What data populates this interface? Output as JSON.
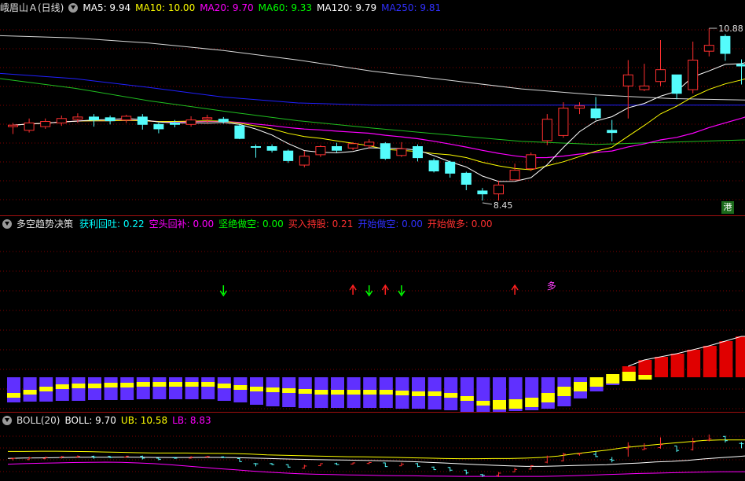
{
  "main_panel": {
    "title": "峨眉山Ａ(日线)",
    "indicators": [
      {
        "label": "MA5:",
        "value": "9.94",
        "color": "#ffffff"
      },
      {
        "label": "MA10:",
        "value": "10.00",
        "color": "#ffff00"
      },
      {
        "label": "MA20:",
        "value": "9.70",
        "color": "#ff00ff"
      },
      {
        "label": "MA60:",
        "value": "9.33",
        "color": "#00ff00"
      },
      {
        "label": "MA120:",
        "value": "9.79",
        "color": "#ffffff"
      },
      {
        "label": "MA250:",
        "value": "9.81",
        "color": "#3030ff"
      }
    ],
    "high_label": "10.88",
    "low_label": "8.45",
    "badge": "港"
  },
  "strategy_panel": {
    "title": "多空趋势决策",
    "indicators": [
      {
        "label": "获利回吐:",
        "value": "0.22",
        "color": "#00ffff"
      },
      {
        "label": "空头回补:",
        "value": "0.00",
        "color": "#ff00ff"
      },
      {
        "label": "坚绝做空:",
        "value": "0.00",
        "color": "#00ff00"
      },
      {
        "label": "买入持股:",
        "value": "0.21",
        "color": "#ff3030"
      },
      {
        "label": "开始做空:",
        "value": "0.00",
        "color": "#3030ff"
      },
      {
        "label": "开始做多:",
        "value": "0.00",
        "color": "#ff3030"
      }
    ],
    "marker_text": "多"
  },
  "boll_panel": {
    "title": "BOLL(20)",
    "indicators": [
      {
        "label": "BOLL:",
        "value": "9.70",
        "color": "#ffffff"
      },
      {
        "label": "UB:",
        "value": "10.58",
        "color": "#ffff00"
      },
      {
        "label": "LB:",
        "value": "8.83",
        "color": "#ff00ff"
      }
    ]
  },
  "colors": {
    "up": "#ff3030",
    "down": "#54fcfc",
    "grid": "#800000",
    "bull_bar": "#e00000",
    "bear_bar": "#6030ff",
    "yellow_band": "#ffff00"
  },
  "chart_data": {
    "type": "candlestick",
    "candles": [
      [
        9.55,
        9.57,
        9.6,
        9.45
      ],
      [
        9.5,
        9.6,
        9.66,
        9.47
      ],
      [
        9.55,
        9.62,
        9.66,
        9.52
      ],
      [
        9.6,
        9.66,
        9.7,
        9.56
      ],
      [
        9.65,
        9.68,
        9.73,
        9.6
      ],
      [
        9.68,
        9.64,
        9.72,
        9.55
      ],
      [
        9.67,
        9.63,
        9.7,
        9.58
      ],
      [
        9.64,
        9.69,
        9.71,
        9.6
      ],
      [
        9.68,
        9.58,
        9.72,
        9.51
      ],
      [
        9.58,
        9.52,
        9.6,
        9.46
      ],
      [
        9.6,
        9.58,
        9.64,
        9.54
      ],
      [
        9.58,
        9.64,
        9.69,
        9.55
      ],
      [
        9.65,
        9.67,
        9.71,
        9.6
      ],
      [
        9.65,
        9.62,
        9.68,
        9.59
      ],
      [
        9.56,
        9.39,
        9.58,
        9.38
      ],
      [
        9.28,
        9.27,
        9.31,
        9.13
      ],
      [
        9.28,
        9.23,
        9.31,
        9.2
      ],
      [
        9.22,
        9.09,
        9.24,
        9.06
      ],
      [
        9.03,
        9.15,
        9.22,
        9.0
      ],
      [
        9.17,
        9.28,
        9.3,
        9.14
      ],
      [
        9.28,
        9.23,
        9.33,
        9.2
      ],
      [
        9.26,
        9.32,
        9.34,
        9.23
      ],
      [
        9.29,
        9.34,
        9.38,
        9.25
      ],
      [
        9.32,
        9.12,
        9.34,
        9.1
      ],
      [
        9.16,
        9.25,
        9.34,
        9.14
      ],
      [
        9.28,
        9.13,
        9.31,
        9.08
      ],
      [
        9.09,
        8.95,
        9.12,
        8.93
      ],
      [
        9.07,
        8.92,
        9.09,
        8.86
      ],
      [
        8.92,
        8.77,
        8.94,
        8.69
      ],
      [
        8.68,
        8.64,
        8.72,
        8.55
      ],
      [
        8.64,
        8.76,
        8.82,
        8.55
      ],
      [
        8.83,
        8.96,
        9.05,
        8.83
      ],
      [
        8.98,
        9.17,
        9.2,
        8.95
      ],
      [
        9.36,
        9.65,
        9.72,
        9.3
      ],
      [
        9.43,
        9.8,
        9.88,
        9.4
      ],
      [
        9.8,
        9.83,
        9.88,
        9.72
      ],
      [
        9.79,
        9.67,
        9.95,
        9.64
      ],
      [
        9.5,
        9.47,
        9.64,
        9.35
      ],
      [
        10.1,
        10.25,
        10.45,
        9.66
      ],
      [
        10.05,
        10.1,
        10.4,
        10.03
      ],
      [
        10.16,
        10.32,
        10.72,
        10.1
      ],
      [
        10.25,
        10.0,
        10.25,
        9.92
      ],
      [
        10.05,
        10.45,
        10.7,
        10.0
      ],
      [
        10.57,
        10.65,
        10.88,
        10.5
      ],
      [
        10.77,
        10.54,
        10.8,
        10.44
      ],
      [
        10.39,
        10.37,
        10.46,
        10.12
      ],
      [
        10.7,
        10.3,
        10.72,
        10.22
      ],
      [
        10.78,
        10.44,
        10.8,
        10.1
      ]
    ],
    "price_range": [
      8.35,
      11.05
    ],
    "ma_series": [
      "MA5",
      "MA10",
      "MA20",
      "MA60",
      "MA120",
      "MA250"
    ]
  }
}
